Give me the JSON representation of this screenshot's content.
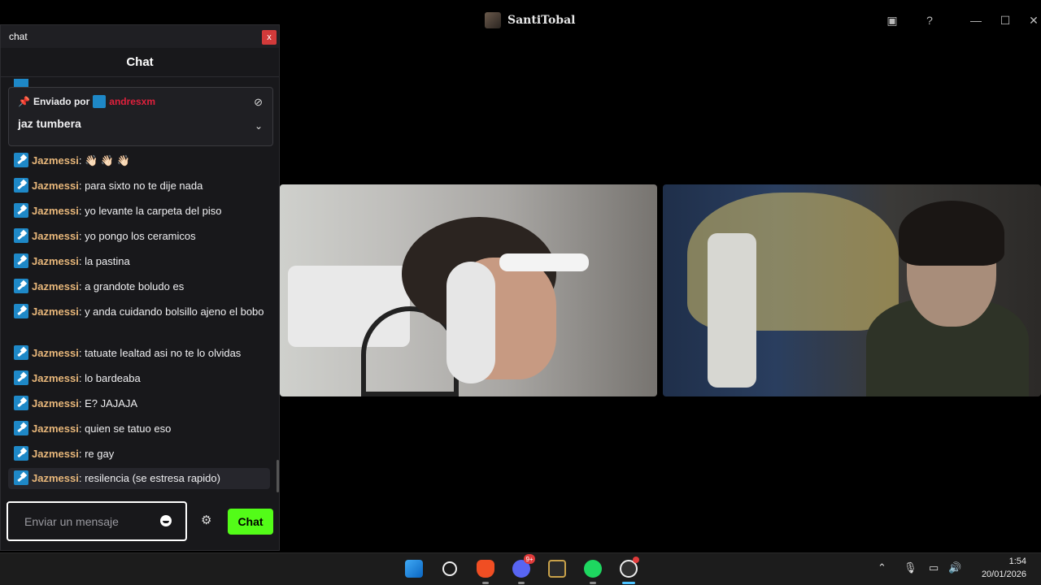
{
  "window": {
    "title": "SantiTobal"
  },
  "chat_popup": {
    "window_label": "chat",
    "close_label": "x",
    "header": "Chat",
    "pinned": {
      "sent_by_label": "Enviado por",
      "user": "andresxm",
      "message": "jaz tumbera"
    },
    "messages": [
      {
        "user": "Jazmessi",
        "text": "👋🏻 👋🏻 👋🏻"
      },
      {
        "user": "Jazmessi",
        "text": "para sixto no te dije nada"
      },
      {
        "user": "Jazmessi",
        "text": "yo levante la carpeta del piso"
      },
      {
        "user": "Jazmessi",
        "text": "yo pongo los ceramicos"
      },
      {
        "user": "Jazmessi",
        "text": "la pastina"
      },
      {
        "user": "Jazmessi",
        "text": "a grandote boludo es"
      },
      {
        "user": "Jazmessi",
        "text": "y anda cuidando bolsillo ajeno el bobo"
      },
      {
        "user": "Jazmessi",
        "text": "tatuate lealtad asi no te lo olvidas"
      },
      {
        "user": "Jazmessi",
        "text": "lo bardeaba"
      },
      {
        "user": "Jazmessi",
        "text": "E? JAJAJA"
      },
      {
        "user": "Jazmessi",
        "text": "quien se tatuo eso"
      },
      {
        "user": "Jazmessi",
        "text": "re gay"
      },
      {
        "user": "Jazmessi",
        "text": "resilencia (se estresa rapido)"
      }
    ],
    "input_placeholder": "Enviar un mensaje",
    "send_label": "Chat"
  },
  "taskbar": {
    "discord_badge": "9+",
    "time": "1:54",
    "date": "20/01/2026"
  },
  "colors": {
    "accent_green": "#53fc18",
    "username": "#e8b77a",
    "pinned_user": "#e0203c",
    "background": "#18181b"
  }
}
